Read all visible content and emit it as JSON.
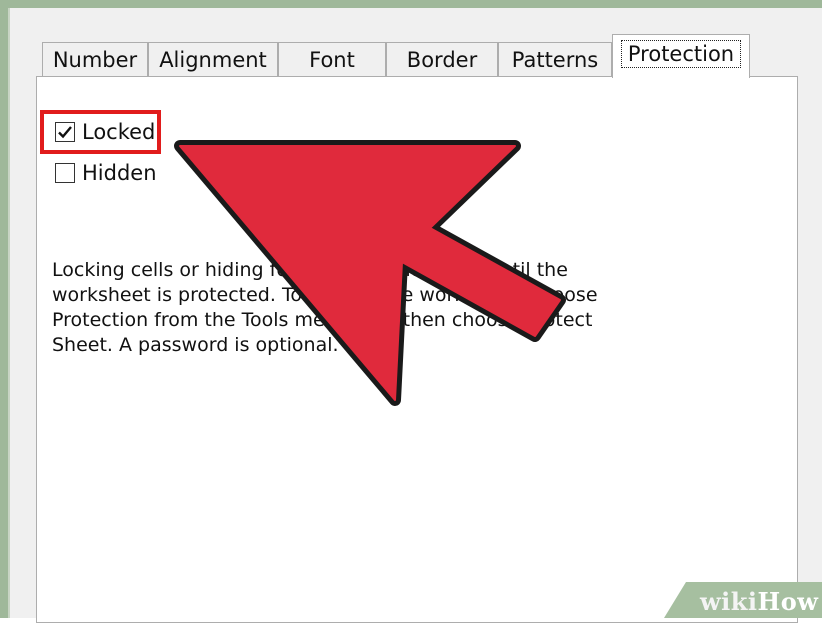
{
  "tabs": [
    {
      "label": "Number",
      "active": false
    },
    {
      "label": "Alignment",
      "active": false
    },
    {
      "label": "Font",
      "active": false
    },
    {
      "label": "Border",
      "active": false
    },
    {
      "label": "Patterns",
      "active": false
    },
    {
      "label": "Protection",
      "active": true
    }
  ],
  "options": {
    "locked": {
      "label": "Locked",
      "checked": true
    },
    "hidden": {
      "label": "Hidden",
      "checked": false
    }
  },
  "description": [
    "Locking cells or hiding formulas has no effect until the",
    "worksheet is protected. To protect the worksheet, choose",
    "Protection from the Tools menu, and then choose Protect",
    "Sheet. A password is optional."
  ],
  "annotation": {
    "arrow_color": "#e02a3c",
    "highlight_color": "#e11c1c"
  },
  "watermark": {
    "wiki": "wiki",
    "how": "How"
  }
}
